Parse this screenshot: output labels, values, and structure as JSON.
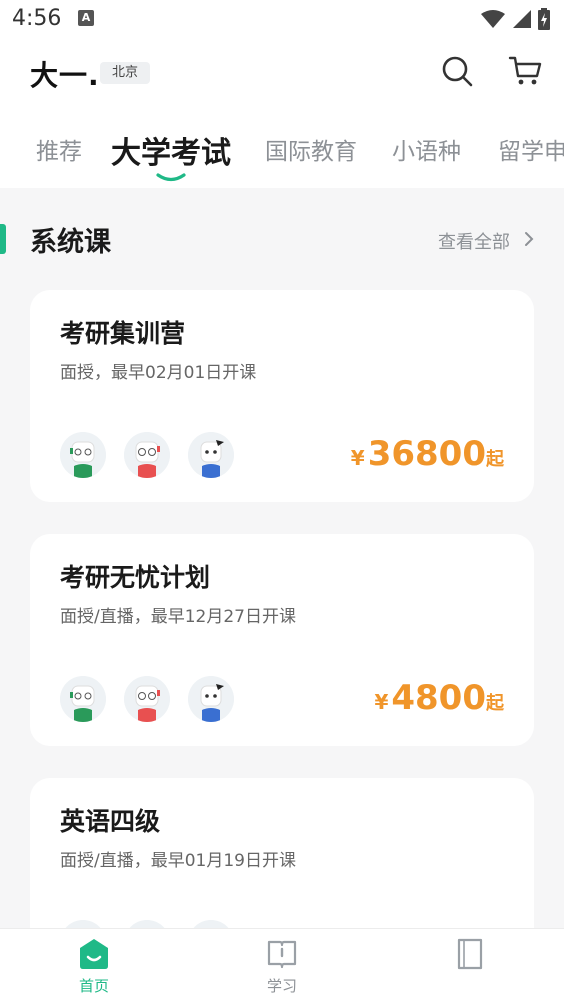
{
  "status_bar": {
    "time": "4:56",
    "notification_glyph": "A"
  },
  "header": {
    "brand": "大一.",
    "city": "北京"
  },
  "tabs": [
    {
      "label": "推荐",
      "active": false
    },
    {
      "label": "大学考试",
      "active": true
    },
    {
      "label": "国际教育",
      "active": false
    },
    {
      "label": "小语种",
      "active": false
    },
    {
      "label": "留学申",
      "active": false
    }
  ],
  "section": {
    "title": "系统课",
    "view_all": "查看全部"
  },
  "courses": [
    {
      "title": "考研集训营",
      "subtitle": "面授，最早02月01日开课",
      "currency": "¥",
      "price": "36800",
      "price_suffix": "起"
    },
    {
      "title": "考研无忧计划",
      "subtitle": "面授/直播，最早12月27日开课",
      "currency": "¥",
      "price": "4800",
      "price_suffix": "起"
    },
    {
      "title": "英语四级",
      "subtitle": "面授/直播，最早01月19日开课",
      "currency": "¥",
      "price": "",
      "price_suffix": ""
    }
  ],
  "bottom_nav": [
    {
      "label": "首页",
      "icon": "home-icon",
      "active": true
    },
    {
      "label": "学习",
      "icon": "book-icon",
      "active": false
    },
    {
      "label": "",
      "icon": "profile-icon",
      "active": false
    }
  ],
  "colors": {
    "accent": "#1fb987",
    "price": "#f0952a",
    "background": "#f6f6f7"
  }
}
